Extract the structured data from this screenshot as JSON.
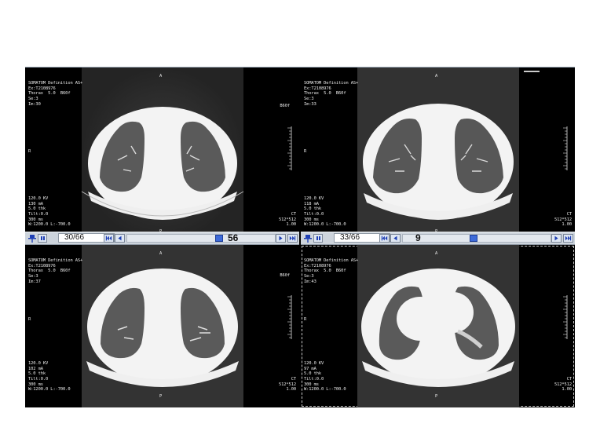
{
  "app": {
    "name": "CT multi-viewport viewer",
    "accent": "#3e6bd9",
    "toolbar_bg": "#cdd4dc"
  },
  "panes": [
    {
      "id": "top-left",
      "info_top": [
        "SOMATOM Definition AS+",
        "Ex:T2108976",
        "Thorax  5.0  B60f",
        "Se:3",
        "Im:30"
      ],
      "info_bottom": [
        "120.0 KV",
        "130 mA",
        "5.0 thk",
        "Tilt:0.0",
        "300 ms",
        "W:1200.0 L:-700.0"
      ],
      "info_br": [
        "CT",
        "512*512",
        "1.00"
      ],
      "orient_top": "A",
      "orient_bottom": "P",
      "orient_side": "R",
      "kernel_right": "B60f"
    },
    {
      "id": "top-right",
      "info_top": [
        "SOMATOM Definition AS+",
        "Ex:T2108976",
        "Thorax  5.0  B60f",
        "Se:3",
        "Im:33"
      ],
      "info_bottom": [
        "120.0 KV",
        "118 mA",
        "5.0 thk",
        "Tilt:0.0",
        "300 ms",
        "W:1200.0 L:-700.0"
      ],
      "info_br": [
        "CT",
        "512*512",
        "1.00"
      ],
      "orient_top": "A",
      "orient_bottom": "P",
      "orient_side": "R",
      "kernel_right": ""
    },
    {
      "id": "bottom-left",
      "info_top": [
        "SOMATOM Definition AS+",
        "Ex:T2108976",
        "Thorax  5.0  B60f",
        "Se:3",
        "Im:37"
      ],
      "info_bottom": [
        "120.0 KV",
        "102 mA",
        "5.0 thk",
        "Tilt:0.0",
        "300 ms",
        "W:1200.0 L:-700.0"
      ],
      "info_br": [
        "CT",
        "512*512",
        "1.00"
      ],
      "orient_top": "A",
      "orient_bottom": "P",
      "orient_side": "R",
      "kernel_right": "B60f"
    },
    {
      "id": "bottom-right",
      "info_top": [
        "SOMATOM Definition AS+",
        "Ex:T2108976",
        "Thorax  5.0  B60f",
        "Se:3",
        "Im:43"
      ],
      "info_bottom": [
        "120.0 KV",
        "97 mA",
        "5.0 thk",
        "Tilt:0.0",
        "300 ms",
        "W:1200.0 L:-700.0"
      ],
      "info_br": [
        "CT",
        "512*512",
        "1.00"
      ],
      "orient_top": "A",
      "orient_bottom": "P",
      "orient_side": "R",
      "kernel_right": ""
    }
  ],
  "toolbars": [
    {
      "icons": [
        "pin-icon",
        "pause-icon"
      ],
      "slice_current": "30",
      "slice_total": "/66",
      "slider_value": "56",
      "slider_fraction": 0.63
    },
    {
      "icons": [
        "pin-icon",
        "pause-icon"
      ],
      "slice_current": "33",
      "slice_total": "/66",
      "slider_value": "9",
      "slider_fraction": 0.48
    }
  ],
  "icons": [
    "first-frame-icon",
    "prev-frame-icon",
    "next-frame-icon",
    "last-frame-icon"
  ]
}
